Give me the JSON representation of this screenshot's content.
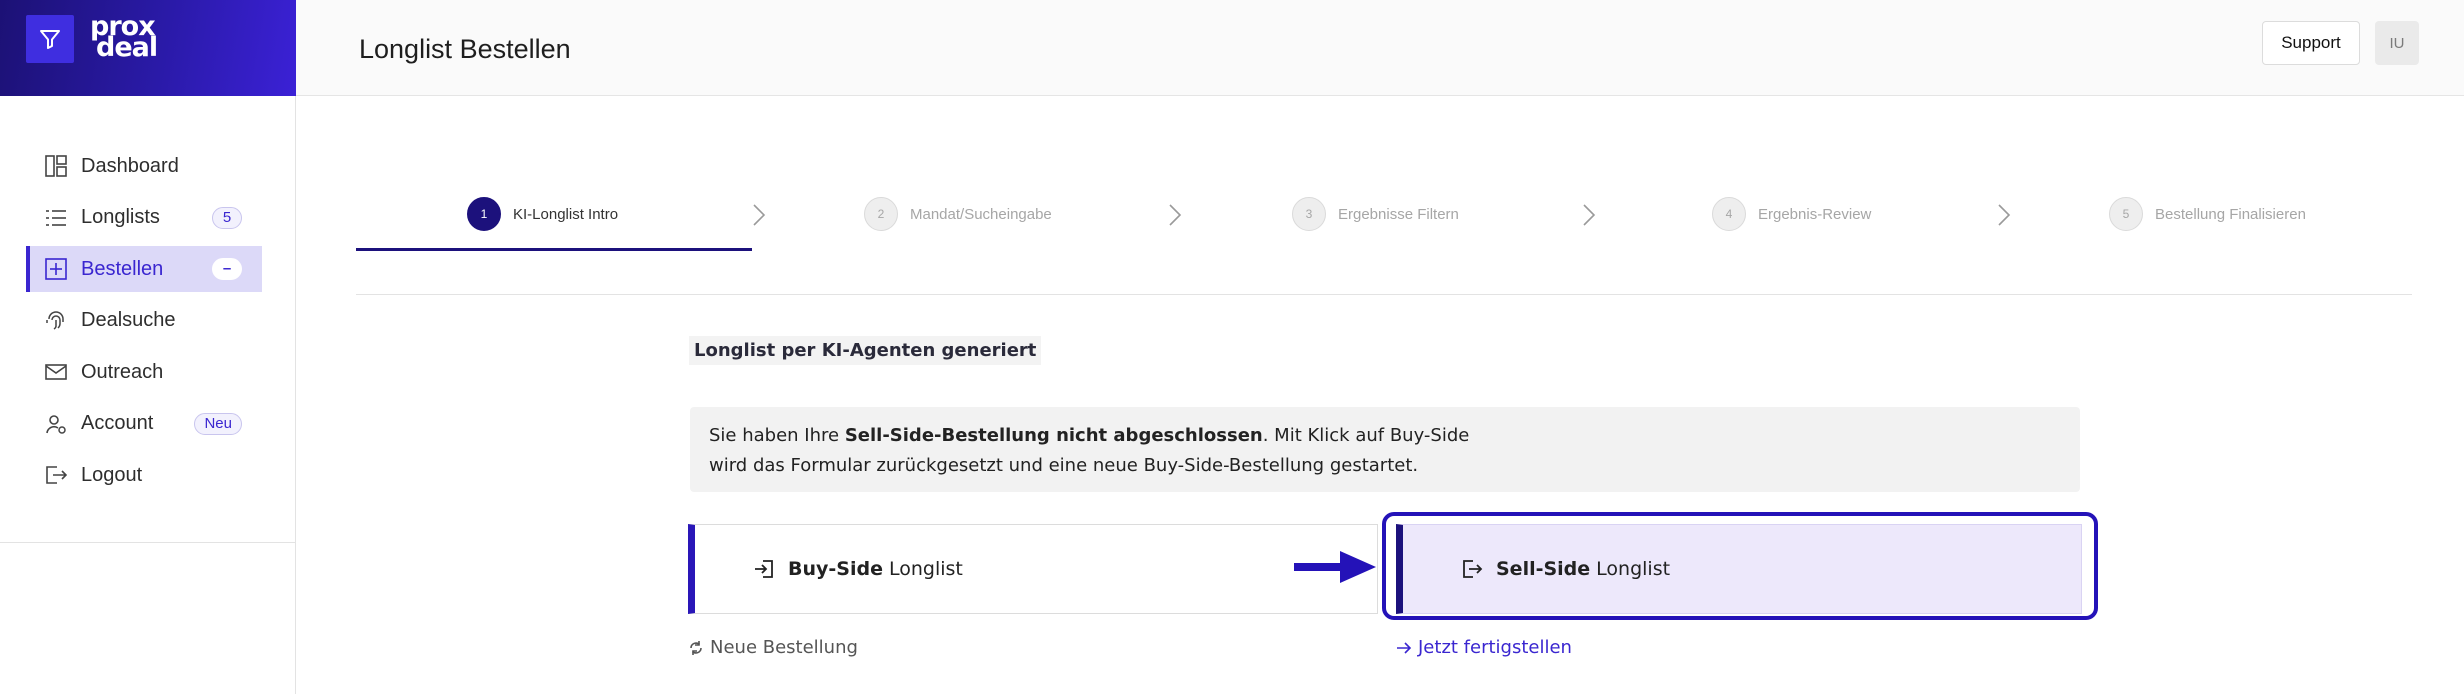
{
  "brand": {
    "logo_line1": "prox",
    "logo_line2": "deal",
    "accent": "#3a26d0"
  },
  "sidebar": {
    "items": [
      {
        "label": "Dashboard",
        "icon": "dashboard-icon",
        "badge": ""
      },
      {
        "label": "Longlists",
        "icon": "list-icon",
        "badge": "5"
      },
      {
        "label": "Bestellen",
        "icon": "plus-square-icon",
        "badge": "–",
        "active": true
      },
      {
        "label": "Dealsuche",
        "icon": "fingerprint-icon",
        "badge": ""
      },
      {
        "label": "Outreach",
        "icon": "mail-icon",
        "badge": ""
      },
      {
        "label": "Account",
        "icon": "user-gear-icon",
        "badge": "Neu"
      },
      {
        "label": "Logout",
        "icon": "logout-icon",
        "badge": ""
      }
    ]
  },
  "header": {
    "title": "Longlist Bestellen",
    "support_label": "Support",
    "avatar_initials": "IU"
  },
  "stepper": {
    "steps": [
      {
        "num": "1",
        "label": "KI-Longlist Intro",
        "active": true
      },
      {
        "num": "2",
        "label": "Mandat/Sucheingabe"
      },
      {
        "num": "3",
        "label": "Ergebnisse Filtern"
      },
      {
        "num": "4",
        "label": "Ergebnis-Review"
      },
      {
        "num": "5",
        "label": "Bestellung Finalisieren"
      }
    ]
  },
  "main": {
    "section_label": "Longlist per KI-Agenten generiert",
    "notice": {
      "pre": "Sie haben Ihre ",
      "bold": "Sell-Side-Bestellung nicht abgeschlossen",
      "post1": ". Mit Klick auf Buy-Side",
      "post2": "wird das Formular zurückgesetzt und eine neue Buy-Side-Bestellung gestartet."
    },
    "options": {
      "buy": {
        "bold": "Buy-Side",
        "rest": "Longlist",
        "icon": "login-icon"
      },
      "sell": {
        "bold": "Sell-Side",
        "rest": "Longlist",
        "icon": "logout-icon"
      }
    },
    "links": {
      "new_order": "Neue Bestellung",
      "finish": "Jetzt fertigstellen"
    }
  }
}
